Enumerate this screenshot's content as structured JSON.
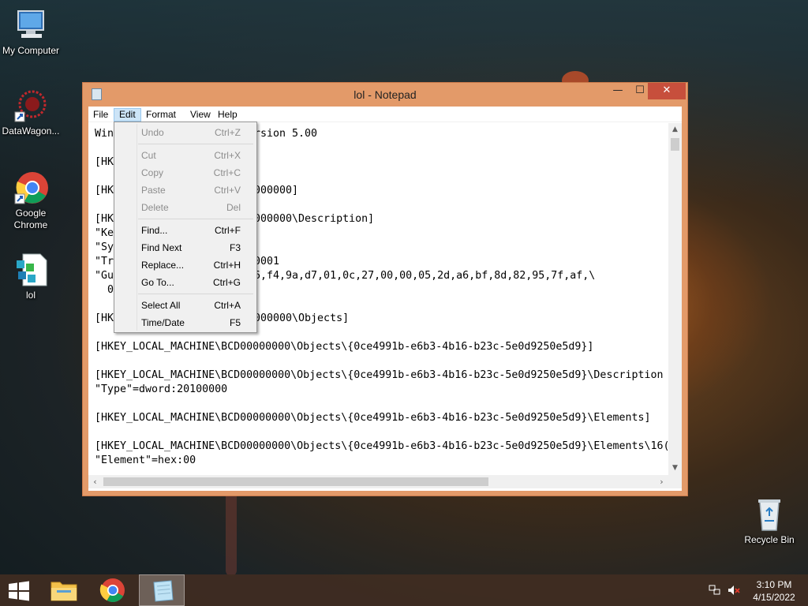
{
  "desktop": {
    "icons": [
      {
        "label": "My Computer"
      },
      {
        "label": "DataWagon..."
      },
      {
        "label": "Google Chrome"
      },
      {
        "label": "lol"
      },
      {
        "label": "Recycle Bin"
      }
    ]
  },
  "window": {
    "title": "lol - Notepad",
    "menu": [
      "File",
      "Edit",
      "Format",
      "View",
      "Help"
    ]
  },
  "editor": {
    "lines": [
      "Win",
      "",
      "[HK",
      "",
      "[HK",
      "",
      "[HK",
      "\"Ke",
      "\"Sy",
      "\"Tr",
      "\"Gu",
      "  0",
      "",
      "[HK",
      "",
      "[HKEY_LOCAL_MACHINE\\BCD00000000\\Objects\\{0ce4991b-e6b3-4b16-b23c-5e0d9250e5d9}]",
      "",
      "[HKEY_LOCAL_MACHINE\\BCD00000000\\Objects\\{0ce4991b-e6b3-4b16-b23c-5e0d9250e5d9}\\Description",
      "\"Type\"=dword:20100000",
      "",
      "[HKEY_LOCAL_MACHINE\\BCD00000000\\Objects\\{0ce4991b-e6b3-4b16-b23c-5e0d9250e5d9}\\Elements]",
      "",
      "[HKEY_LOCAL_MACHINE\\BCD00000000\\Objects\\{0ce4991b-e6b3-4b16-b23c-5e0d9250e5d9}\\Elements\\16(",
      "\"Element\"=hex:00"
    ],
    "right_fragments": [
      {
        "line": 0,
        "text": "rsion 5.00"
      },
      {
        "line": 4,
        "text": "000000]"
      },
      {
        "line": 6,
        "text": "000000\\Description]"
      },
      {
        "line": 9,
        "text": "0001"
      },
      {
        "line": 10,
        "text": "6,f4,9a,d7,01,0c,27,00,00,05,2d,a6,bf,8d,82,95,7f,af,\\"
      },
      {
        "line": 13,
        "text": "000000\\Objects]"
      }
    ]
  },
  "edit_menu": {
    "items": [
      {
        "label": "Undo",
        "shortcut": "Ctrl+Z",
        "disabled": true
      },
      {
        "sep": true
      },
      {
        "label": "Cut",
        "shortcut": "Ctrl+X",
        "disabled": true
      },
      {
        "label": "Copy",
        "shortcut": "Ctrl+C",
        "disabled": true
      },
      {
        "label": "Paste",
        "shortcut": "Ctrl+V",
        "disabled": true
      },
      {
        "label": "Delete",
        "shortcut": "Del",
        "disabled": true
      },
      {
        "sep": true
      },
      {
        "label": "Find...",
        "shortcut": "Ctrl+F",
        "disabled": false
      },
      {
        "label": "Find Next",
        "shortcut": "F3",
        "disabled": false
      },
      {
        "label": "Replace...",
        "shortcut": "Ctrl+H",
        "disabled": false
      },
      {
        "label": "Go To...",
        "shortcut": "Ctrl+G",
        "disabled": false
      },
      {
        "sep": true
      },
      {
        "label": "Select All",
        "shortcut": "Ctrl+A",
        "disabled": false
      },
      {
        "label": "Time/Date",
        "shortcut": "F5",
        "disabled": false
      }
    ]
  },
  "taskbar": {
    "time": "3:10 PM",
    "date": "4/15/2022"
  }
}
